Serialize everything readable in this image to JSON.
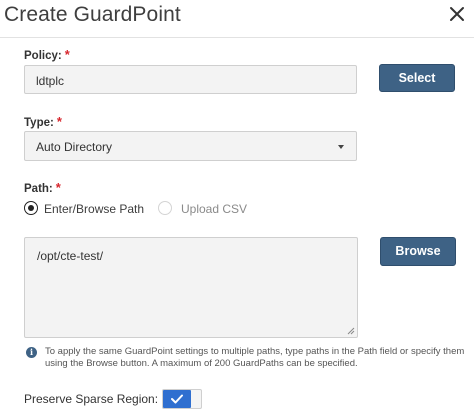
{
  "dialog": {
    "title": "Create GuardPoint",
    "close_icon": "close-icon"
  },
  "policy": {
    "label": "Policy:",
    "required": "*",
    "value": "ldtplc",
    "select_button": "Select"
  },
  "type": {
    "label": "Type:",
    "required": "*",
    "selected": "Auto Directory",
    "dropdown_icon": "caret-down-icon"
  },
  "path": {
    "label": "Path:",
    "required": "*",
    "options": [
      {
        "label": "Enter/Browse Path",
        "selected": true
      },
      {
        "label": "Upload CSV",
        "selected": false
      }
    ],
    "value": "/opt/cte-test/",
    "browse_button": "Browse"
  },
  "info": {
    "icon": "info-icon",
    "text": "To apply the same GuardPoint settings to multiple paths, type paths in the Path field or specify them using the Browse button. A maximum of 200 GuardPaths can be specified."
  },
  "preserve_sparse": {
    "label": "Preserve Sparse Region:",
    "enabled": true
  },
  "colors": {
    "button_bg": "#3e6285",
    "required": "#d7262d",
    "toggle_on": "#2f6fd0"
  }
}
